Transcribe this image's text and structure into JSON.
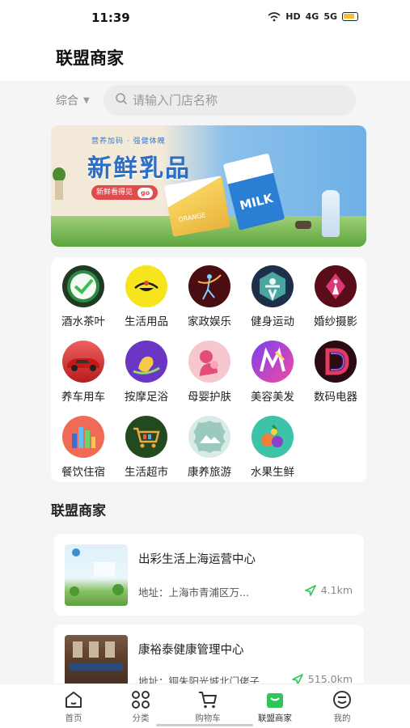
{
  "status_bar": {
    "time": "11:39",
    "network": "HD",
    "signal1": "4G",
    "signal2": "5G"
  },
  "header": {
    "title": "联盟商家"
  },
  "search": {
    "filter_label": "综合",
    "placeholder": "请输入门店名称"
  },
  "banner": {
    "tag": "营养加码 · 强健体魄",
    "title": "新鲜乳品",
    "pill": "新鲜看得见",
    "go": "go",
    "milk_text": "MILK",
    "box_text": "ORANGE"
  },
  "categories": [
    {
      "label": "酒水茶叶",
      "icon": "tea-leaf-icon"
    },
    {
      "label": "生活用品",
      "icon": "household-icon"
    },
    {
      "label": "家政娱乐",
      "icon": "dancer-icon"
    },
    {
      "label": "健身运动",
      "icon": "fitness-icon"
    },
    {
      "label": "婚纱摄影",
      "icon": "wedding-dress-icon"
    },
    {
      "label": "养车用车",
      "icon": "car-icon"
    },
    {
      "label": "按摩足浴",
      "icon": "foot-massage-icon"
    },
    {
      "label": "母婴护肤",
      "icon": "mother-baby-icon"
    },
    {
      "label": "美容美发",
      "icon": "beauty-icon"
    },
    {
      "label": "数码电器",
      "icon": "digital-icon"
    },
    {
      "label": "餐饮住宿",
      "icon": "dining-icon"
    },
    {
      "label": "生活超市",
      "icon": "supermarket-cart-icon"
    },
    {
      "label": "康养旅游",
      "icon": "travel-mountain-icon"
    },
    {
      "label": "水果生鲜",
      "icon": "fruit-icon"
    }
  ],
  "section": {
    "title": "联盟商家"
  },
  "merchants": [
    {
      "name": "出彩生活上海运营中心",
      "address": "地址：上海市青浦区万...",
      "distance": "4.1km"
    },
    {
      "name": "康裕泰健康管理中心",
      "address": "地址：铜朱阳光城北门佬子",
      "distance": "515.0km"
    }
  ],
  "tabbar": [
    {
      "label": "首页",
      "icon": "home-icon"
    },
    {
      "label": "分类",
      "icon": "category-icon"
    },
    {
      "label": "购物车",
      "icon": "cart-icon"
    },
    {
      "label": "联盟商家",
      "icon": "shop-bag-icon"
    },
    {
      "label": "我的",
      "icon": "profile-icon"
    }
  ],
  "colors": {
    "accent": "#2fc55a",
    "background": "#f5f5f5",
    "distance_icon": "#2fc55a"
  }
}
